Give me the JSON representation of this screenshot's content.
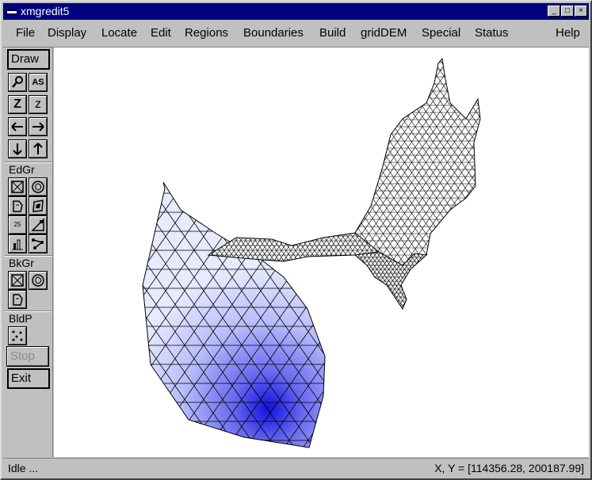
{
  "window": {
    "title": "xmgredit5"
  },
  "window_buttons": [
    "_",
    "□",
    "×"
  ],
  "menu": [
    {
      "label": "File"
    },
    {
      "label": "Display"
    },
    {
      "label": "Locate"
    },
    {
      "label": "Edit"
    },
    {
      "label": "Regions"
    },
    {
      "label": "Boundaries"
    },
    {
      "label": "Build"
    },
    {
      "label": "gridDEM"
    },
    {
      "label": "Special"
    },
    {
      "label": "Status"
    },
    {
      "label": "Help"
    }
  ],
  "toolbar": {
    "draw_label": "Draw",
    "edgr_label": "EdGr",
    "bkgr_label": "BkGr",
    "bldp_label": "BldP",
    "stop_label": "Stop",
    "exit_label": "Exit",
    "zoom_in": "Z",
    "zoom_out": "z",
    "autoscale_glyph": "AS",
    "ratio_glyph": "25"
  },
  "status": {
    "left": "Idle ...",
    "right": "X, Y = [114356.28, 200187.99]"
  },
  "colors": {
    "title_bg": "#000080",
    "mesh_line": "#000000",
    "fill_light": "#e8eaff",
    "fill_dark": "#1010e0"
  }
}
